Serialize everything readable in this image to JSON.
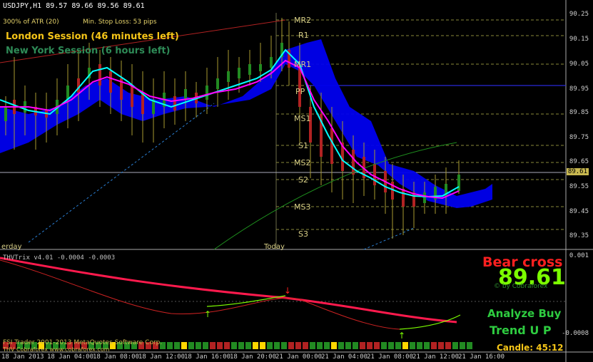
{
  "symbol_info": "USDJPY,H1  89.57 89.66 89.56 89.61",
  "atr_label": "300% of ATR (20)",
  "stop_loss_label": "Min. Stop Loss:  53 pips",
  "london_session": "London Session (46 minutes left)",
  "newyork_session": "New York Session (6 hours left)",
  "current_price_box": "89.61",
  "levels": [
    "MR2",
    "R1",
    "MR1",
    "PP",
    "MS1",
    "S1",
    "MS2",
    "S2",
    "MS3",
    "S3"
  ],
  "y_axis": [
    "90.25",
    "90.15",
    "90.05",
    "89.95",
    "89.85",
    "89.75",
    "89.65",
    "89.55",
    "89.45",
    "89.35"
  ],
  "day_labels": [
    "erday",
    "Today"
  ],
  "indicator_subtitle": "THVTrix v4.01 -0.0004 -0.0003",
  "indicator_axis": [
    "0.001",
    "-0.0008"
  ],
  "copyright_1": "FSI Trader    2001-2013 MetaQuotes Software Corp.",
  "copyright_2": "THV   Cobraforex   www.cobraforex.com",
  "signal": "Bear cross",
  "big_price": "89.61",
  "watermark": "© by Cobraforex",
  "analyze": "Analyze Buy",
  "trend": "Trend U P",
  "candle_timer": "Candle:  45:12",
  "x_axis": [
    "18 Jan 2013",
    "18 Jan 04:00",
    "18 Jan 08:00",
    "18 Jan 12:00",
    "18 Jan 16:00",
    "18 Jan 20:00",
    "21 Jan 00:00",
    "21 Jan 04:00",
    "21 Jan 08:00",
    "21 Jan 12:00",
    "21 Jan 16:00"
  ],
  "colors": {
    "background": "#000000",
    "candle_up": "#228b22",
    "candle_down": "#b22222",
    "wick": "#a89a30",
    "cloud": "#0000ee",
    "ma_fast": "#00ffff",
    "ma_slow": "#ff00ff",
    "trix_red": "#ff1a4d",
    "trix_green": "#7cfc00",
    "signal_red": "#ff2020",
    "accent_green": "#2ecc40",
    "session_london": "#f5c518",
    "session_ny": "#2e8b57"
  }
}
